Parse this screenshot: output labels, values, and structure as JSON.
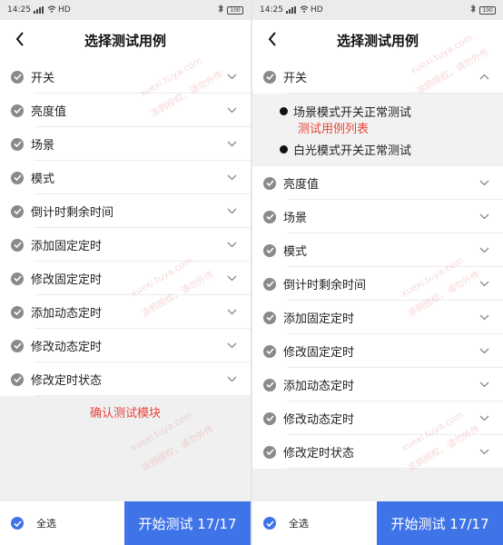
{
  "status": {
    "time": "14:25",
    "network": "HD",
    "battery": "100"
  },
  "header": {
    "title": "选择测试用例"
  },
  "left_items": [
    {
      "label": "开关"
    },
    {
      "label": "亮度值"
    },
    {
      "label": "场景"
    },
    {
      "label": "模式"
    },
    {
      "label": "倒计时剩余时间"
    },
    {
      "label": "添加固定定时"
    },
    {
      "label": "修改固定定时"
    },
    {
      "label": "添加动态定时"
    },
    {
      "label": "修改动态定时"
    },
    {
      "label": "修改定时状态"
    }
  ],
  "left_annotation": "确认测试模块",
  "right_expanded": {
    "label": "开关",
    "children": [
      "场景模式开关正常测试",
      "白光模式开关正常测试"
    ],
    "annotation": "测试用例列表"
  },
  "right_items": [
    {
      "label": "亮度值"
    },
    {
      "label": "场景"
    },
    {
      "label": "模式"
    },
    {
      "label": "倒计时剩余时间"
    },
    {
      "label": "添加固定定时"
    },
    {
      "label": "修改固定定时"
    },
    {
      "label": "添加动态定时"
    },
    {
      "label": "修改动态定时"
    },
    {
      "label": "修改定时状态"
    }
  ],
  "footer": {
    "select_all": "全选",
    "start_button": "开始测试 17/17"
  },
  "watermarks": [
    "xuexi.tuya.com",
    "涂鸦授权，请勿外传"
  ],
  "colors": {
    "accent_blue": "#3f74e8",
    "annotation_red": "#e8453c",
    "check_gray": "#8a8a8a"
  }
}
